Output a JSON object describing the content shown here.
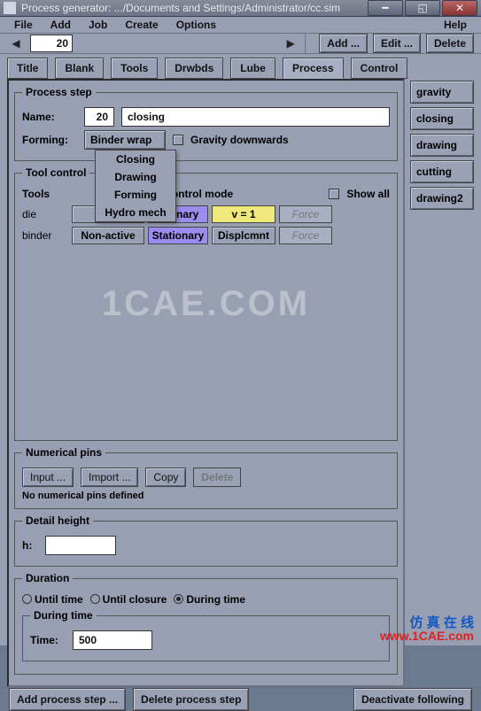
{
  "window": {
    "title": "Process generator: .../Documents and Settings/Administrator/cc.sim"
  },
  "menubar": {
    "file": "File",
    "add": "Add",
    "job": "Job",
    "create": "Create",
    "options": "Options",
    "help": "Help"
  },
  "toolbar": {
    "step_number": "20",
    "add": "Add ...",
    "edit": "Edit ...",
    "delete": "Delete"
  },
  "tabs": {
    "title": "Title",
    "blank": "Blank",
    "tools": "Tools",
    "drwbds": "Drwbds",
    "lube": "Lube",
    "process": "Process",
    "control": "Control"
  },
  "side": {
    "gravity": "gravity",
    "closing": "closing",
    "drawing": "drawing",
    "cutting": "cutting",
    "drawing2": "drawing2"
  },
  "process_step": {
    "legend": "Process step",
    "name_lbl": "Name:",
    "name_num": "20",
    "name_val": "closing",
    "forming_lbl": "Forming:",
    "forming_val": "Binder wrap",
    "gravity": "Gravity downwards",
    "dropdown": [
      "Closing",
      "Drawing",
      "Forming",
      "Hydro mech"
    ]
  },
  "tool_control": {
    "legend": "Tool control",
    "tools_hdr": "Tools",
    "control_hdr": "Control mode",
    "show_all": "Show all",
    "rows": [
      {
        "tool": "die",
        "c1": "No",
        "c2": "ationary",
        "c3": "v = 1",
        "c4": "Force"
      },
      {
        "tool": "binder",
        "c1": "Non-active",
        "c2": "Stationary",
        "c3": "Displcmnt",
        "c4": "Force"
      }
    ]
  },
  "numpins": {
    "legend": "Numerical pins",
    "input": "Input ...",
    "import": "Import ...",
    "copy": "Copy",
    "delete": "Delete",
    "msg": "No numerical pins defined"
  },
  "detail": {
    "legend": "Detail height",
    "h": "h:",
    "val": ""
  },
  "duration": {
    "legend": "Duration",
    "until_time": "Until time",
    "until_closure": "Until closure",
    "during_time": "During time",
    "during_legend": "During time",
    "time_lbl": "Time:",
    "time_val": "500"
  },
  "footer": {
    "add": "Add process step ...",
    "delete": "Delete process step",
    "deactivate": "Deactivate following"
  },
  "watermark": "1CAE.COM",
  "brand": {
    "cn": "仿 真 在 线",
    "url": "www.1CAE.com"
  }
}
